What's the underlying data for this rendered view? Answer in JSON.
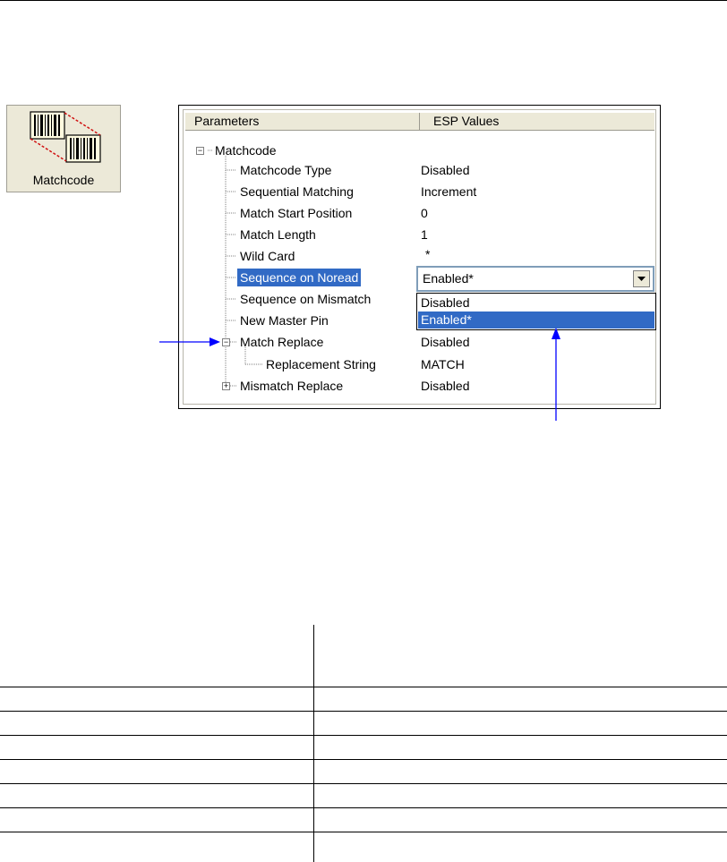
{
  "icon_button": {
    "label": "Matchcode",
    "icon": "barcode-match-icon"
  },
  "tree": {
    "headers": {
      "parameters": "Parameters",
      "values": "ESP Values"
    },
    "root": {
      "label": "Matchcode",
      "expander": "−"
    },
    "rows": [
      {
        "label": "Matchcode Type",
        "value": "Disabled"
      },
      {
        "label": "Sequential Matching",
        "value": "Increment"
      },
      {
        "label": "Match Start Position",
        "value": "0"
      },
      {
        "label": "Match Length",
        "value": "1"
      },
      {
        "label": "Wild Card",
        "value": "*"
      },
      {
        "label": "Sequence on Noread",
        "value": "Enabled*",
        "selected": true
      },
      {
        "label": "Sequence on Mismatch",
        "value": ""
      },
      {
        "label": "New Master Pin",
        "value": ""
      },
      {
        "label": "Match Replace",
        "value": "Disabled",
        "expander": "−"
      },
      {
        "label": "Replacement String",
        "value": "MATCH"
      },
      {
        "label": "Mismatch Replace",
        "value": "Disabled",
        "expander": "+"
      }
    ]
  },
  "dropdown": {
    "selected": "Enabled*",
    "options": [
      "Disabled",
      "Enabled*"
    ],
    "highlighted_index": 1
  },
  "colors": {
    "selection": "#316ac5",
    "arrow": "#0000ff",
    "panel_bg": "#ece9d8"
  }
}
